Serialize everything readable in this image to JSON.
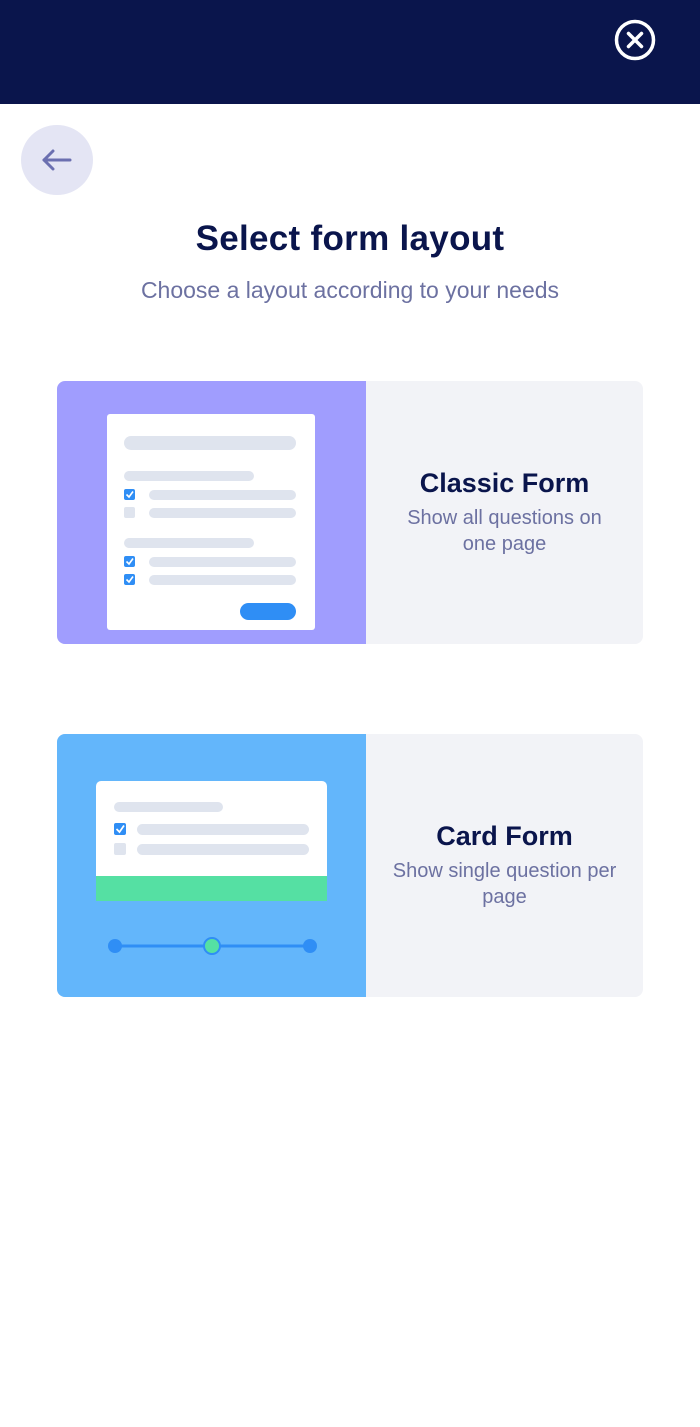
{
  "header": {
    "close_icon": "close-circle-icon",
    "background": "#0a154c"
  },
  "nav": {
    "back_icon": "arrow-left-icon"
  },
  "title": "Select form layout",
  "subtitle": "Choose a layout according to your needs",
  "layouts": [
    {
      "name": "Classic Form",
      "description": "Show all questions on one page",
      "illustration_color": "#a09dfe"
    },
    {
      "name": "Card Form",
      "description": "Show single question per page",
      "illustration_color": "#63b6fb"
    }
  ]
}
